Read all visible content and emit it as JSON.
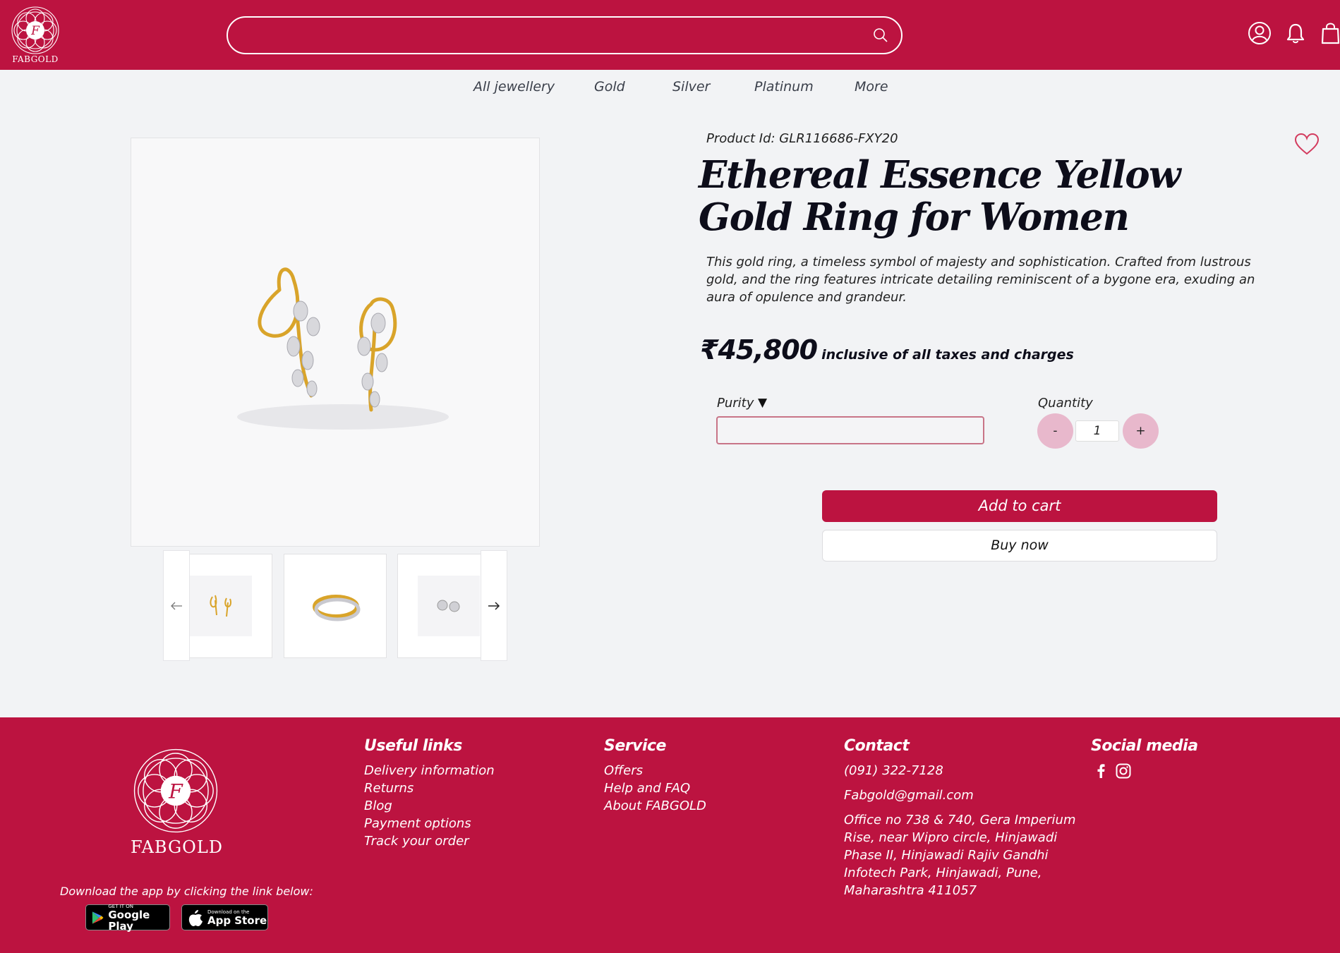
{
  "header": {
    "brand": "FABGOLD",
    "logo_letter": "F",
    "search_placeholder": ""
  },
  "nav": {
    "items": [
      "All jewellery",
      "Gold",
      "Silver",
      "Platinum",
      "More"
    ]
  },
  "product": {
    "id_label": "Product Id: GLR116686-FXY20",
    "title": "Ethereal Essence Yellow Gold Ring for Women",
    "description": "This gold ring, a timeless symbol of majesty and sophistication. Crafted from lustrous gold, and the ring features intricate detailing reminiscent of a bygone era, exuding an aura of opulence and grandeur.",
    "price": "₹45,800",
    "price_note": "inclusive of all taxes and charges",
    "purity_label": "Purity",
    "purity_caret": "▼",
    "purity_value": "",
    "quantity_label": "Quantity",
    "quantity_minus": "-",
    "quantity_plus": "+",
    "quantity_value": "1",
    "add_to_cart": "Add to cart",
    "buy_now": "Buy now"
  },
  "colors": {
    "brand": "#bc1340",
    "qty_button": "#e8b8cc",
    "page_bg": "#f2f3f5"
  },
  "footer": {
    "brand": "FABGOLD",
    "logo_letter": "F",
    "download_text": "Download the app by clicking the link below:",
    "google_play_small": "GET IT ON",
    "google_play_big": "Google Play",
    "app_store_small": "Download on the",
    "app_store_big": "App Store",
    "useful_links": {
      "heading": "Useful links",
      "items": [
        "Delivery information",
        "Returns",
        "Blog",
        "Payment options",
        "Track your order"
      ]
    },
    "service": {
      "heading": "Service",
      "items": [
        "Offers",
        "Help and FAQ",
        "About FABGOLD"
      ]
    },
    "contact": {
      "heading": "Contact",
      "phone": "(091) 322-7128",
      "email": "Fabgold@gmail.com",
      "address": "Office no 738 & 740, Gera Imperium Rise, near Wipro circle, Hinjawadi Phase II, Hinjawadi Rajiv Gandhi Infotech Park, Hinjawadi, Pune, Maharashtra 411057"
    },
    "social": {
      "heading": "Social media",
      "icons": [
        "facebook-icon",
        "instagram-icon"
      ]
    }
  }
}
